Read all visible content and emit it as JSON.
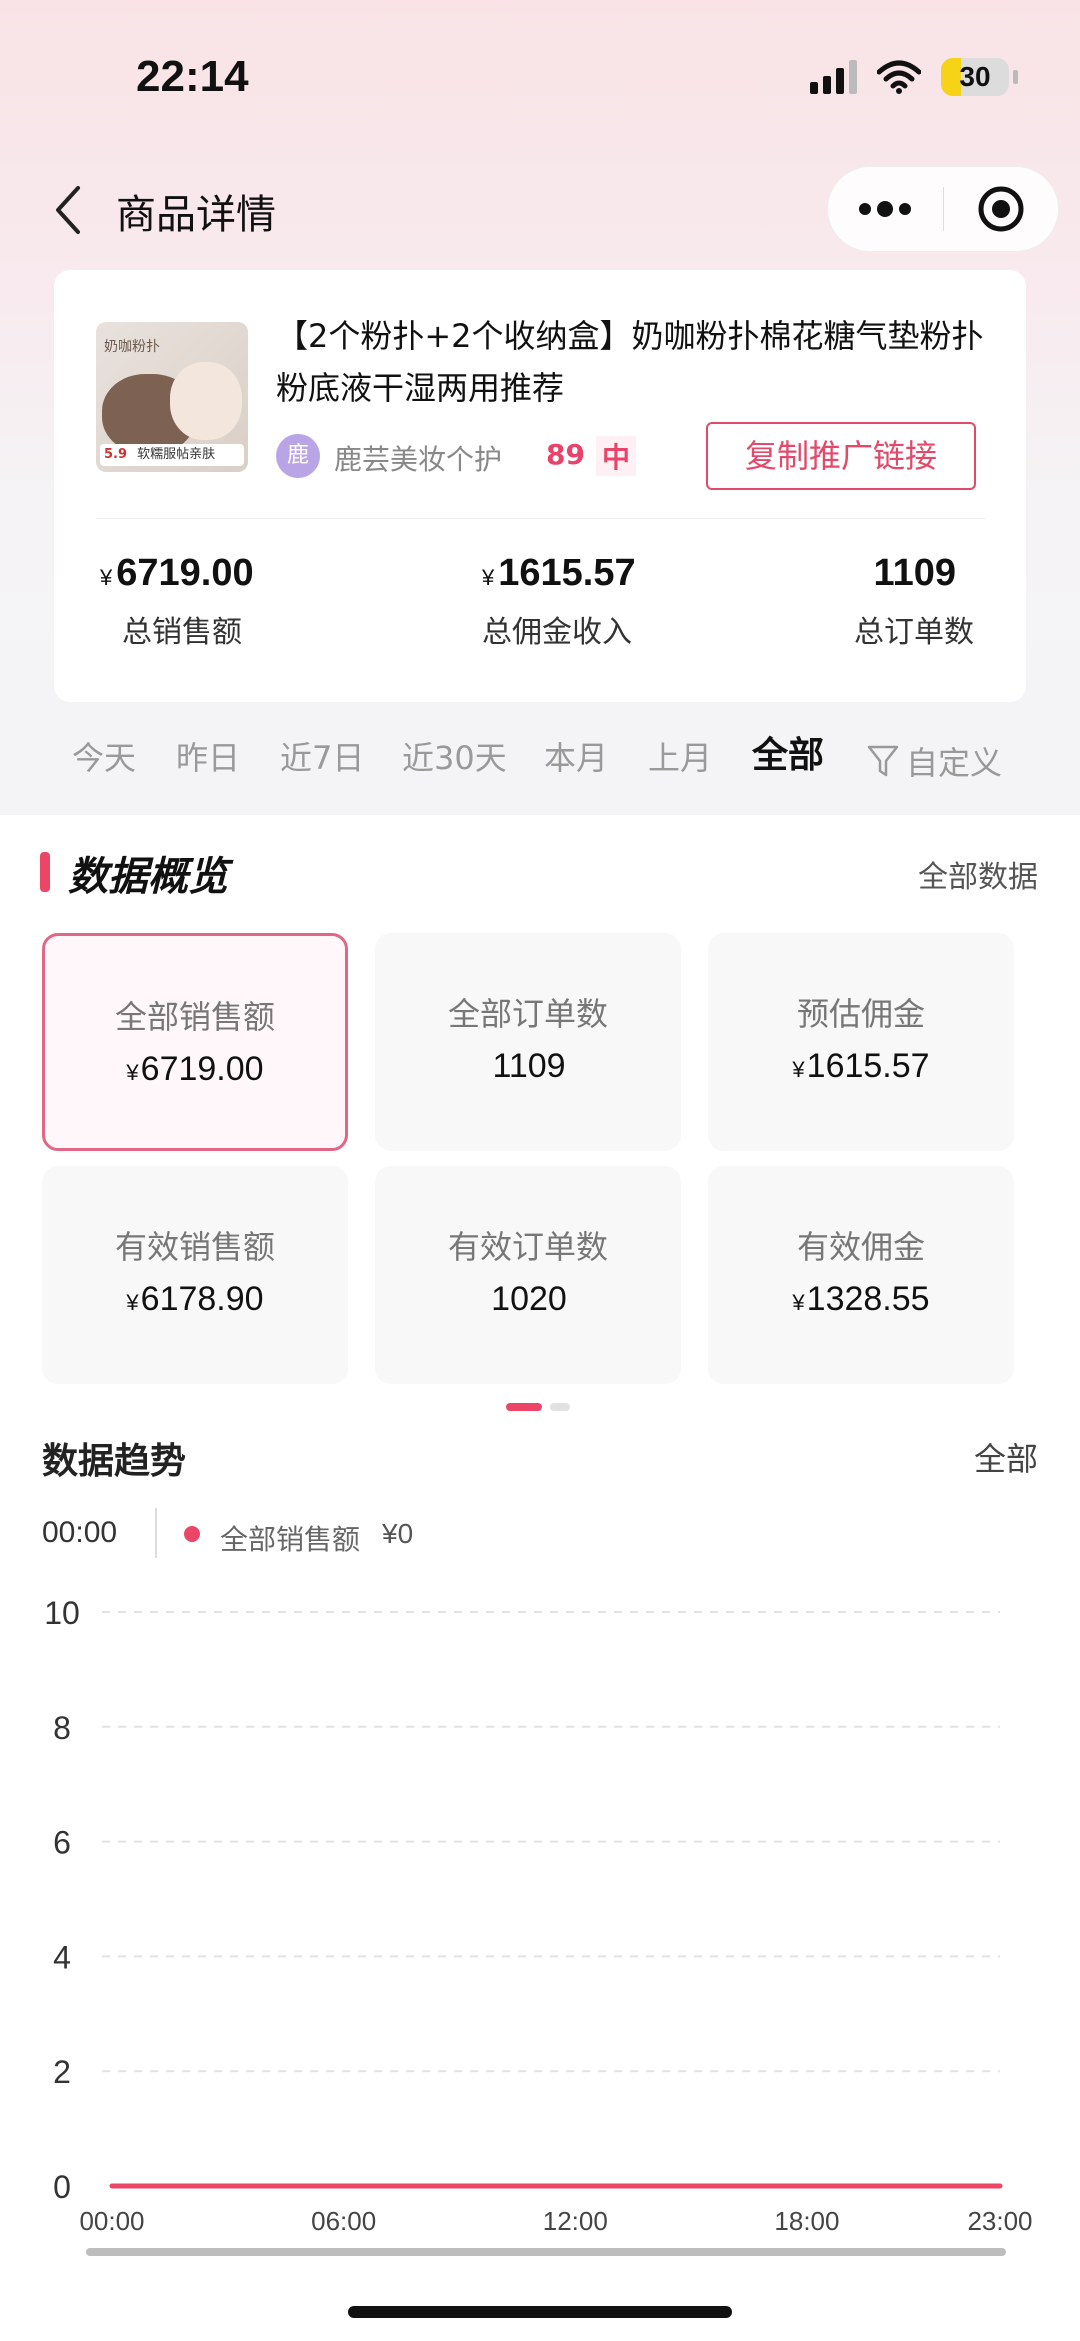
{
  "status_bar": {
    "time": "22:14",
    "battery": "30",
    "battery_level": 0.3
  },
  "nav": {
    "title": "商品详情",
    "back_icon": "chevron-left-icon",
    "more_icon": "more-dots-icon",
    "target_icon": "target-icon"
  },
  "product": {
    "title": "【2个粉扑+2个收纳盒】奶咖粉扑棉花糖气垫粉扑粉底液干湿两用推荐",
    "thumbnail_text": "奶咖粉扑",
    "thumbnail_price": "5.9",
    "thumbnail_tag": "软糯服帖亲肤",
    "shop_avatar": "鹿",
    "shop_name": "鹿芸美妆个护",
    "shop_score": "89",
    "shop_level": "中",
    "copy_button": "复制推广链接"
  },
  "summary": {
    "currency": "¥",
    "sales_value": "6719.00",
    "sales_label": "总销售额",
    "commission_value": "1615.57",
    "commission_label": "总佣金收入",
    "orders_value": "1109",
    "orders_label": "总订单数"
  },
  "tabs": {
    "items": [
      "今天",
      "昨日",
      "近7日",
      "近30天",
      "本月",
      "上月",
      "全部"
    ],
    "active": "全部",
    "custom": "自定义"
  },
  "overview": {
    "title": "数据概览",
    "link": "全部数据",
    "tiles": [
      {
        "label": "全部销售额",
        "yen": "¥",
        "value": "6719.00"
      },
      {
        "label": "全部订单数",
        "yen": "",
        "value": "1109"
      },
      {
        "label": "预估佣金",
        "yen": "¥",
        "value": "1615.57"
      },
      {
        "label": "有效销售额",
        "yen": "¥",
        "value": "6178.90"
      },
      {
        "label": "有效订单数",
        "yen": "",
        "value": "1020"
      },
      {
        "label": "有效佣金",
        "yen": "¥",
        "value": "1328.55"
      }
    ]
  },
  "trend": {
    "title": "数据趋势",
    "link": "全部",
    "legend_time": "00:00",
    "legend_name": "全部销售额",
    "legend_value": "¥0"
  },
  "chart_data": {
    "type": "line",
    "x": [
      "00:00",
      "01:00",
      "02:00",
      "03:00",
      "04:00",
      "05:00",
      "06:00",
      "07:00",
      "08:00",
      "09:00",
      "10:00",
      "11:00",
      "12:00",
      "13:00",
      "14:00",
      "15:00",
      "16:00",
      "17:00",
      "18:00",
      "19:00",
      "20:00",
      "21:00",
      "22:00",
      "23:00"
    ],
    "x_tick_labels": [
      "00:00",
      "06:00",
      "12:00",
      "18:00",
      "23:00"
    ],
    "series": [
      {
        "name": "全部销售额",
        "color": "#ec4667",
        "values": [
          0,
          0,
          0,
          0,
          0,
          0,
          0,
          0,
          0,
          0,
          0,
          0,
          0,
          0,
          0,
          0,
          0,
          0,
          0,
          0,
          0,
          0,
          0,
          0
        ]
      }
    ],
    "y_ticks": [
      0,
      2,
      4,
      6,
      8,
      10
    ],
    "ylim": [
      0,
      10
    ],
    "grid": true
  },
  "colors": {
    "accent": "#ec4667",
    "active_border": "#e06886"
  }
}
